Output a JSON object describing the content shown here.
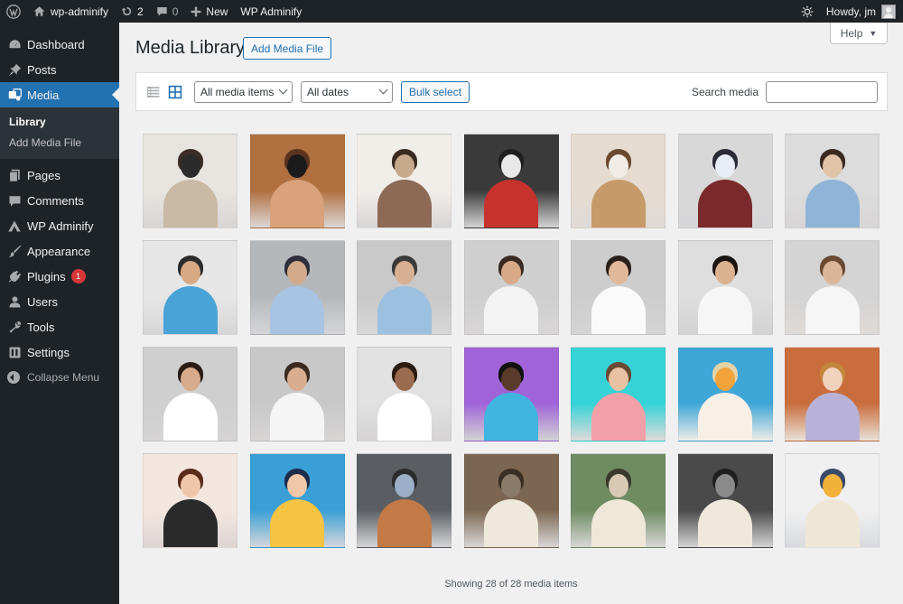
{
  "admin_bar": {
    "site_name": "wp-adminify",
    "updates_count": "2",
    "comments_count": "0",
    "new_label": "New",
    "plugin_label": "WP Adminify",
    "howdy": "Howdy, jm"
  },
  "sidebar": {
    "items": [
      {
        "label": "Dashboard",
        "icon": "dashboard-icon"
      },
      {
        "label": "Posts",
        "icon": "pin-icon"
      },
      {
        "label": "Media",
        "icon": "media-icon"
      },
      {
        "label": "Pages",
        "icon": "pages-icon"
      },
      {
        "label": "Comments",
        "icon": "comment-icon"
      },
      {
        "label": "WP Adminify",
        "icon": "adminify-icon"
      },
      {
        "label": "Appearance",
        "icon": "brush-icon"
      },
      {
        "label": "Plugins",
        "icon": "plug-icon",
        "badge": "1"
      },
      {
        "label": "Users",
        "icon": "user-icon"
      },
      {
        "label": "Tools",
        "icon": "wrench-icon"
      },
      {
        "label": "Settings",
        "icon": "settings-icon"
      }
    ],
    "submenu": [
      "Library",
      "Add Media File"
    ],
    "collapse_label": "Collapse Menu"
  },
  "header": {
    "title": "Media Library",
    "add_button": "Add Media File",
    "help_label": "Help"
  },
  "toolbar": {
    "filter_type": "All media items",
    "filter_date": "All dates",
    "bulk_select": "Bulk select",
    "search_label": "Search media",
    "search_value": ""
  },
  "footer": {
    "status": "Showing 28 of 28 media items"
  },
  "colors": {
    "accent": "#2271b1",
    "sidebar_bg": "#1d2327",
    "badge": "#d63638"
  }
}
